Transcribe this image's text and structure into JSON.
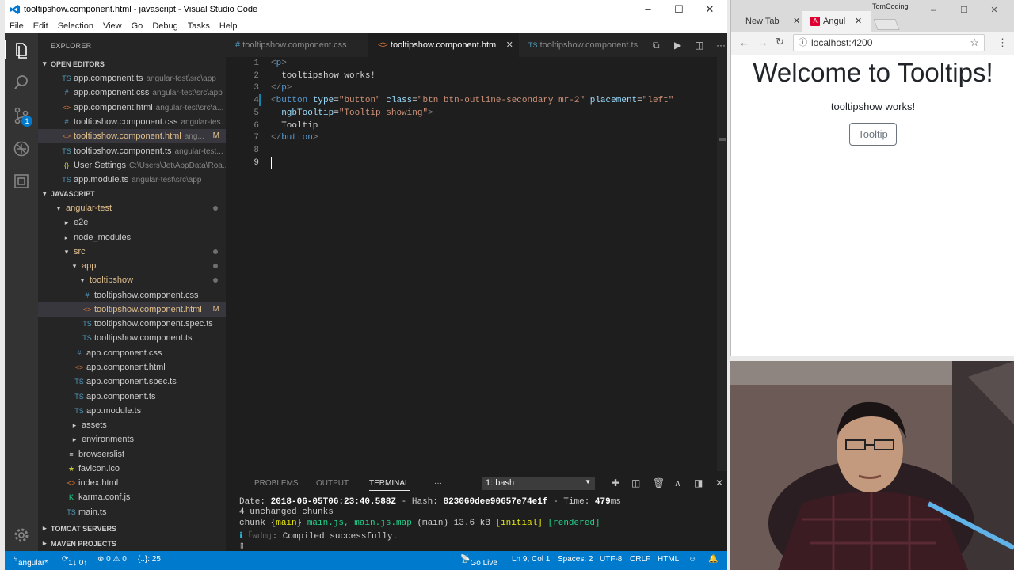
{
  "vscode": {
    "title": "tooltipshow.component.html - javascript - Visual Studio Code",
    "menu": [
      "File",
      "Edit",
      "Selection",
      "View",
      "Go",
      "Debug",
      "Tasks",
      "Help"
    ],
    "activity_badge": "1",
    "explorer": {
      "title": "EXPLORER",
      "open_editors_title": "OPEN EDITORS",
      "open_editors": [
        {
          "name": "app.component.ts",
          "path": "angular-test\\src\\app",
          "icon": "TS"
        },
        {
          "name": "app.component.css",
          "path": "angular-test\\src\\app",
          "icon": "#"
        },
        {
          "name": "app.component.html",
          "path": "angular-test\\src\\a...",
          "icon": "<>"
        },
        {
          "name": "tooltipshow.component.css",
          "path": "angular-tes...",
          "icon": "#"
        },
        {
          "name": "tooltipshow.component.html",
          "path": "ang...",
          "icon": "<>",
          "badge": "M"
        },
        {
          "name": "tooltipshow.component.ts",
          "path": "angular-test...",
          "icon": "TS"
        },
        {
          "name": "User Settings",
          "path": "C:\\Users\\Jet\\AppData\\Roa...",
          "icon": "{}"
        },
        {
          "name": "app.module.ts",
          "path": "angular-test\\src\\app",
          "icon": "TS"
        }
      ],
      "folder_title": "JAVASCRIPT",
      "tree": [
        {
          "name": "angular-test",
          "icon": "▾"
        },
        {
          "name": "e2e",
          "icon": "▸"
        },
        {
          "name": "node_modules",
          "icon": "▸"
        },
        {
          "name": "src",
          "icon": "▾"
        },
        {
          "name": "app",
          "icon": "▾"
        },
        {
          "name": "tooltipshow",
          "icon": "▾"
        },
        {
          "name": "tooltipshow.component.css",
          "icon": "#"
        },
        {
          "name": "tooltipshow.component.html",
          "icon": "<>",
          "badge": "M"
        },
        {
          "name": "tooltipshow.component.spec.ts",
          "icon": "TS"
        },
        {
          "name": "tooltipshow.component.ts",
          "icon": "TS"
        },
        {
          "name": "app.component.css",
          "icon": "#"
        },
        {
          "name": "app.component.html",
          "icon": "<>"
        },
        {
          "name": "app.component.spec.ts",
          "icon": "TS"
        },
        {
          "name": "app.component.ts",
          "icon": "TS"
        },
        {
          "name": "app.module.ts",
          "icon": "TS"
        },
        {
          "name": "assets",
          "icon": "▸"
        },
        {
          "name": "environments",
          "icon": "▸"
        },
        {
          "name": "browserslist",
          "icon": "≡"
        },
        {
          "name": "favicon.ico",
          "icon": "★"
        },
        {
          "name": "index.html",
          "icon": "<>"
        },
        {
          "name": "karma.conf.js",
          "icon": "K"
        },
        {
          "name": "main.ts",
          "icon": "TS"
        }
      ],
      "bottom_sections": [
        "TOMCAT SERVERS",
        "MAVEN PROJECTS"
      ]
    },
    "tabs": [
      {
        "label": "tooltipshow.component.css",
        "icon": "#"
      },
      {
        "label": "tooltipshow.component.html",
        "icon": "<>",
        "active": true,
        "close": "✕"
      },
      {
        "label": "tooltipshow.component.ts",
        "icon": "TS"
      }
    ],
    "code_lines": [
      {
        "n": "1",
        "parts": [
          [
            "t-brk",
            "<"
          ],
          [
            "t-tag",
            "p"
          ],
          [
            "t-brk",
            ">"
          ]
        ]
      },
      {
        "n": "2",
        "parts": [
          [
            "",
            "  tooltipshow works!"
          ]
        ]
      },
      {
        "n": "3",
        "parts": [
          [
            "t-brk",
            "</"
          ],
          [
            "t-tag",
            "p"
          ],
          [
            "t-brk",
            ">"
          ]
        ]
      },
      {
        "n": "4",
        "parts": [
          [
            "t-brk",
            "<"
          ],
          [
            "t-tag",
            "button"
          ],
          [
            "",
            " "
          ],
          [
            "t-attr",
            "type"
          ],
          [
            "",
            "="
          ],
          [
            "t-str",
            "\"button\""
          ],
          [
            "",
            " "
          ],
          [
            "t-attr",
            "class"
          ],
          [
            "",
            "="
          ],
          [
            "t-str",
            "\"btn btn-outline-secondary mr-2\""
          ],
          [
            "",
            " "
          ],
          [
            "t-attr",
            "placement"
          ],
          [
            "",
            "="
          ],
          [
            "t-str",
            "\"left\""
          ]
        ]
      },
      {
        "n": "5",
        "parts": [
          [
            "",
            "  "
          ],
          [
            "t-attr",
            "ngbTooltip"
          ],
          [
            "",
            "="
          ],
          [
            "t-str",
            "\"Tooltip showing\""
          ],
          [
            "t-brk",
            ">"
          ]
        ]
      },
      {
        "n": "6",
        "parts": [
          [
            "",
            "  Tooltip"
          ]
        ]
      },
      {
        "n": "7",
        "parts": [
          [
            "t-brk",
            "</"
          ],
          [
            "t-tag",
            "button"
          ],
          [
            "t-brk",
            ">"
          ]
        ]
      },
      {
        "n": "8",
        "parts": []
      },
      {
        "n": "9",
        "parts": []
      }
    ],
    "panel": {
      "tabs": [
        "PROBLEMS",
        "OUTPUT",
        "TERMINAL"
      ],
      "more": "···",
      "terminal_select": "1: bash",
      "lines": [
        [
          [
            "",
            "Date: "
          ],
          [
            "k-b",
            "2018-06-05T06:23:40.588Z"
          ],
          [
            "",
            " - Hash: "
          ],
          [
            "k-b",
            "823060dee90657e74e1f"
          ],
          [
            "",
            " - Time: "
          ],
          [
            "k-b",
            "479"
          ],
          [
            "",
            "ms"
          ]
        ],
        [
          [
            "",
            "4 unchanged chunks"
          ]
        ],
        [
          [
            "",
            "chunk {"
          ],
          [
            "k-y",
            "main"
          ],
          [
            "",
            "} "
          ],
          [
            "k-g",
            "main.js, main.js.map"
          ],
          [
            "",
            " (main) 13.6 kB "
          ],
          [
            "k-y",
            "[initial]"
          ],
          [
            "",
            " "
          ],
          [
            "k-g",
            "[rendered]"
          ]
        ],
        [
          [
            "k-c",
            "ℹ"
          ],
          [
            "",
            " "
          ],
          [
            "k-d",
            "｢wdm｣"
          ],
          [
            "",
            ": Compiled successfully."
          ]
        ],
        [
          [
            "",
            "▯"
          ]
        ]
      ]
    },
    "status": {
      "branch": "angular*",
      "sync": "1↓ 0↑",
      "errors": "⊗ 0 ⚠ 0",
      "symbols": "{..}: 25",
      "golive": "Go Live",
      "position": "Ln 9, Col 1",
      "spaces": "Spaces: 2",
      "encoding": "UTF-8",
      "eol": "CRLF",
      "lang": "HTML"
    }
  },
  "chrome": {
    "profile": "TomCoding",
    "tabs": [
      {
        "label": "New Tab",
        "close": "✕"
      },
      {
        "label": "Angul",
        "close": "✕"
      }
    ],
    "url": "localhost:4200",
    "page": {
      "heading": "Welcome to Tooltips!",
      "text": "tooltipshow works!",
      "button": "Tooltip"
    }
  }
}
